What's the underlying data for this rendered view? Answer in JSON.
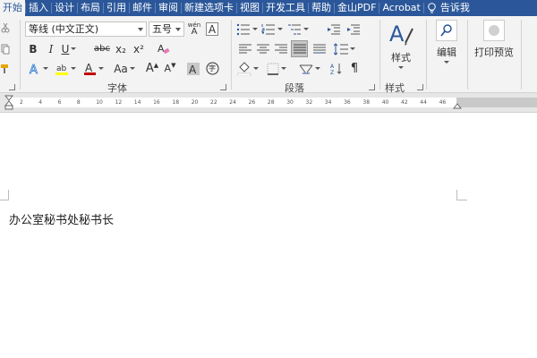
{
  "tabs": [
    {
      "label": "开始",
      "active": true
    },
    {
      "label": "插入"
    },
    {
      "label": "设计"
    },
    {
      "label": "布局"
    },
    {
      "label": "引用"
    },
    {
      "label": "邮件"
    },
    {
      "label": "审阅"
    },
    {
      "label": "新建选项卡"
    },
    {
      "label": "视图"
    },
    {
      "label": "开发工具"
    },
    {
      "label": "帮助"
    },
    {
      "label": "金山PDF"
    },
    {
      "label": "Acrobat"
    }
  ],
  "tell_me": "告诉我",
  "font": {
    "name": "等线 (中文正文)",
    "size": "五号",
    "group_label": "字体",
    "bold": "B",
    "italic": "I",
    "underline": "U",
    "strike": "abc",
    "subscript": "x₂",
    "superscript": "x²",
    "case": "Aa",
    "grow": "A",
    "shrink": "A",
    "char_border": "A",
    "phonetic_top": "wén",
    "phonetic_char": "A",
    "enclose": "字"
  },
  "paragraph": {
    "group_label": "段落"
  },
  "styles": {
    "label": "样式",
    "group_label": "样式"
  },
  "editing": {
    "label": "编辑"
  },
  "print_preview": {
    "label": "打印预览"
  },
  "ruler_ticks": [
    "2",
    "4",
    "6",
    "8",
    "10",
    "12",
    "14",
    "16",
    "18",
    "20",
    "22",
    "24",
    "26",
    "28",
    "30",
    "32",
    "34",
    "36",
    "38",
    "40",
    "42",
    "44",
    "46"
  ],
  "document": {
    "text": "办公室秘书处秘书长"
  },
  "colors": {
    "accent": "#2b579a",
    "highlight": "#ffff00",
    "font_color": "#c00000"
  }
}
